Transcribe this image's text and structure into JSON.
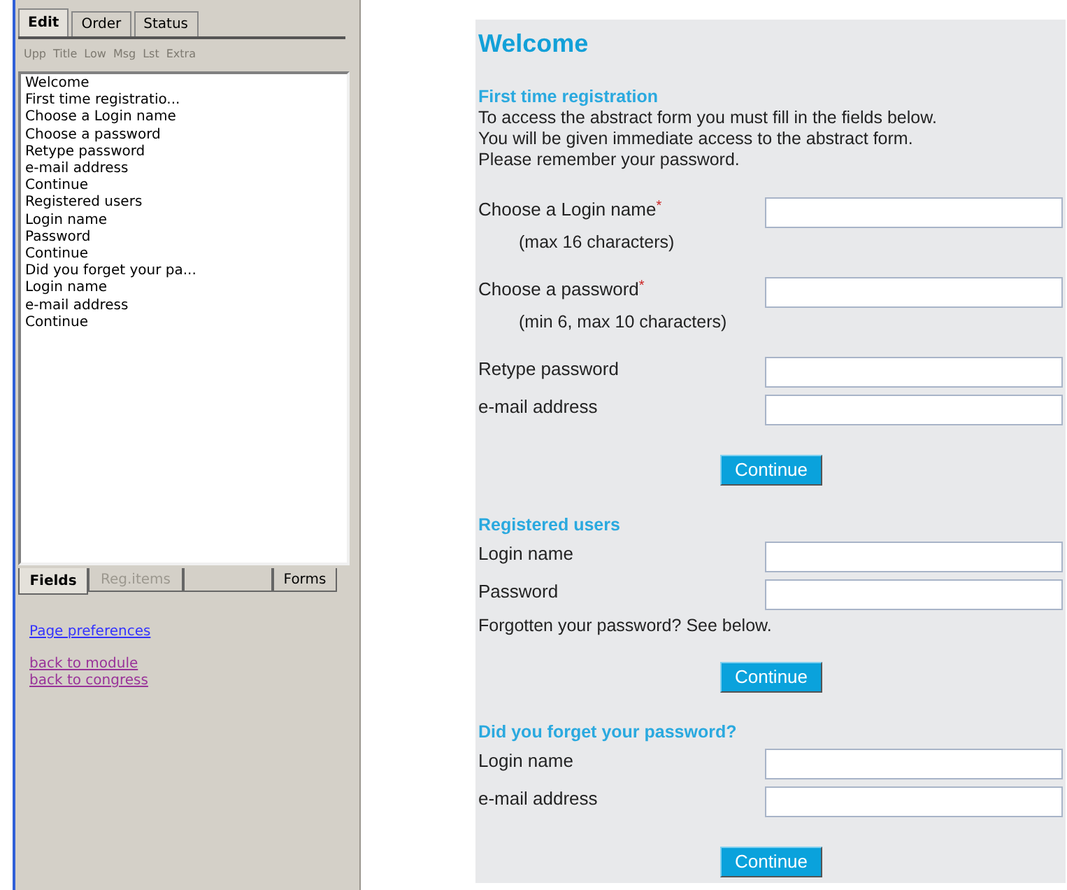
{
  "top_tabs": [
    {
      "label": "Edit",
      "selected": true
    },
    {
      "label": "Order",
      "selected": false
    },
    {
      "label": "Status",
      "selected": false
    }
  ],
  "toolbar": [
    {
      "label": "Upp",
      "disabled": true
    },
    {
      "label": "Title",
      "disabled": true
    },
    {
      "label": "Low",
      "disabled": true
    },
    {
      "label": "Msg",
      "disabled": true
    },
    {
      "label": "Lst",
      "disabled": true
    },
    {
      "label": "Extra",
      "disabled": true
    }
  ],
  "field_list": [
    "Welcome",
    "First time registratio...",
    "Choose a Login name",
    "Choose a password",
    "Retype password",
    "e-mail address",
    "Continue",
    "Registered users",
    "Login name",
    "Password",
    "Continue",
    "Did you forget your pa...",
    "Login name",
    "e-mail address",
    "Continue"
  ],
  "bottom_tabs": [
    {
      "label": "Fields",
      "selected": true,
      "disabled": false
    },
    {
      "label": "Reg.items",
      "selected": false,
      "disabled": true
    },
    {
      "label": "Forms",
      "selected": false,
      "disabled": false
    }
  ],
  "links": [
    {
      "label": "Page preferences",
      "visited": false
    },
    {
      "label": "back to module",
      "visited": true
    },
    {
      "label": "back to congress",
      "visited": true
    }
  ],
  "form": [
    {
      "kind": "title",
      "text": "Welcome"
    },
    {
      "kind": "heading",
      "text": "First time registration"
    },
    {
      "kind": "paragraph",
      "lines": [
        "To access the abstract form you must fill in the fields below.",
        "You will be given immediate access to the abstract form.",
        "Please remember your password."
      ]
    },
    {
      "kind": "field",
      "label": "Choose a Login name",
      "required_mark": "*",
      "hint": "(max 16 characters)"
    },
    {
      "kind": "field",
      "label": "Choose a password",
      "required_mark": "*",
      "hint": "(min 6, max 10 characters)"
    },
    {
      "kind": "field",
      "label": "Retype password"
    },
    {
      "kind": "field",
      "label": "e-mail address"
    },
    {
      "kind": "button",
      "label": "Continue"
    },
    {
      "kind": "heading",
      "text": "Registered users"
    },
    {
      "kind": "field",
      "label": "Login name"
    },
    {
      "kind": "field",
      "label": "Password"
    },
    {
      "kind": "note",
      "text": "Forgotten your password? See below."
    },
    {
      "kind": "button",
      "label": "Continue"
    },
    {
      "kind": "heading",
      "text": "Did you forget your password?"
    },
    {
      "kind": "field",
      "label": "Login name"
    },
    {
      "kind": "field",
      "label": "e-mail address"
    },
    {
      "kind": "button",
      "label": "Continue"
    }
  ]
}
